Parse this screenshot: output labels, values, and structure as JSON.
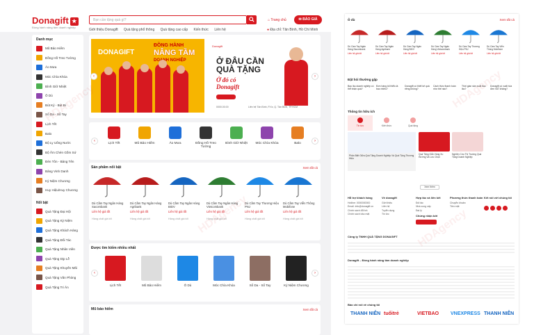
{
  "header": {
    "brand": "Donagift",
    "tagline": "Đồng hành nâng tầm doanh nghiệp",
    "search_placeholder": "Bạn cần tặng quà gì?",
    "home_link": "Trang chủ",
    "quote_button": "BÁO GIÁ",
    "location": "Địa chỉ: Tân Bình, Hồ Chí Minh",
    "nav": [
      "Giới thiệu Donagift",
      "Quà tặng phổ thông",
      "Quà tặng cao cấp",
      "Kiến thức",
      "Liên hệ"
    ]
  },
  "sidebar": {
    "title_categories": "Danh mục",
    "categories": [
      "Mũ Bảo Hiểm",
      "Đồng Hồ Treo Tường",
      "Áo Mưa",
      "Móc Chìa Khóa",
      "Bình Giữ Nhiệt",
      "Ô Dù",
      "Bút Ký - Bút Bi",
      "Sổ Da - Sổ Tay",
      "Lịch Tết",
      "Balo",
      "Bộ Ly Uống Nước",
      "Bộ Ấm Chén Gốm Sứ",
      "Đèn Tôn - Bảng Tên",
      "Bảng Vinh Danh",
      "Kỷ Niệm Chương",
      "Huy Hiệu/Huy Chương"
    ],
    "title_featured": "Nổi bật",
    "featured": [
      "Quà Tặng Đại Hội",
      "Quà Tặng Kỷ Niệm",
      "Quà Tặng Khách Hàng",
      "Quà Tặng Đối Tác",
      "Quà Tặng Nhân Viên",
      "Quà Tặng Dịp Lễ",
      "Quà Tặng Khuyến Mãi",
      "Quà Tặng Văn Phòng",
      "Quà Tặng Tri Ân"
    ]
  },
  "banner": {
    "left_brand": "DONAGIFT",
    "left_line1": "ĐỒNG HÀNH",
    "left_line2": "NÂNG TẦM",
    "left_line3": "DOANH NGHIỆP",
    "right_small": "Donagift",
    "right_title1": "Ở ĐÂU CẦN",
    "right_title2": "QUÀ TẶNG",
    "right_script1": "Ở đó có",
    "right_script2": "Donagift",
    "right_phone": "0000.00.00",
    "right_address": "Liên hệ Tân Bình, P.Xx, Q. Tân Bình, TP.HCM"
  },
  "quick_categories": [
    "Lịch Tết",
    "Mũ Bảo Hiểm",
    "Áo Mưa",
    "Đồng Hồ Treo Tường",
    "Bình Giữ Nhiệt",
    "Móc Chìa Khóa",
    "Balo"
  ],
  "featured_section": {
    "title": "Sản phẩm nổi bật",
    "more": "Xem tất cả",
    "products": [
      {
        "name": "Dù Cầm Tay Ngân Hàng Sacombank",
        "price": "Liên hệ giá tốt",
        "stock": "Hàng chất giá tốt"
      },
      {
        "name": "Dù Cầm Tay Ngân Hàng Agribank",
        "price": "Liên hệ giá tốt",
        "stock": "Hàng chất giá tốt"
      },
      {
        "name": "Dù Cầm Tay Ngân Hàng BIDV",
        "price": "Liên hệ giá tốt",
        "stock": "Hàng chất giá tốt"
      },
      {
        "name": "Dù Cầm Tay Ngân Hàng Vietcombank",
        "price": "Liên hệ giá tốt",
        "stock": "Hàng chất giá tốt"
      },
      {
        "name": "Dù Cầm Tay Thương Hiệu PNJ",
        "price": "Liên hệ giá tốt",
        "stock": "Hàng chất giá tốt"
      },
      {
        "name": "Dù Cầm Tay Viễn Thông Mobifone",
        "price": "Liên hệ giá tốt",
        "stock": "Hàng chất giá tốt"
      }
    ]
  },
  "searched_section": {
    "title": "Được tìm kiếm nhiều nhất",
    "items": [
      "Lịch Tết",
      "Mũ Bảo Hiểm",
      "Ô Dù",
      "Móc Chìa Khóa",
      "Sổ Da - Sổ Tay",
      "Kỷ Niệm Chương"
    ]
  },
  "helmet_section": {
    "title": "Mũ bảo hiểm",
    "more": "Xem tất cả"
  },
  "right_panel": {
    "umbrella_title": "Ô dù",
    "umbrella_more": "Xem tất cả",
    "umbrellas": [
      {
        "name": "Dù Cầm Tay Ngân Hàng Sacombank",
        "price": "Liên hệ giá tốt"
      },
      {
        "name": "Dù Cầm Tay Ngân Hàng Agribank",
        "price": "Liên hệ giá tốt"
      },
      {
        "name": "Dù Cầm Tay Ngân Hàng BIDV",
        "price": "Liên hệ giá tốt"
      },
      {
        "name": "Dù Cầm Tay Ngân Hàng Vietcombank",
        "price": "Liên hệ giá tốt"
      },
      {
        "name": "Dù Cầm Tay Thương Hiệu PNJ",
        "price": "Liên hệ giá tốt"
      },
      {
        "name": "Dù Cầm Tay Viễn Thông Mobifone",
        "price": "Liên hệ giá tốt"
      }
    ],
    "qa_title": "Đặt hỏi thường gặp",
    "qa": [
      "Bao lâu doanh nghiệp có thể nhận quà?",
      "Đơn hàng tối thiểu là bao nhiêu?",
      "Donagift có thiết kế quà riêng không?",
      "Cách thức thanh toán như thế nào?",
      "Thời gian sản xuất bao lâu?",
      "Donagift có xuất hóa đơn VAT không?"
    ],
    "news_title": "Thông tin hữu ích",
    "tabs": [
      "Tin tức",
      "Kiến thức",
      "Quà tặng"
    ],
    "news_hero": "Phân Biệt Giữa Quà Tặng Doanh Nghiệp Và Quà Tặng Thương Hiệu",
    "news": [
      "Quà Tặng Gắn Vàng Xu Hướng Và Lưu Chọn",
      "Nghiên Cứu Thị Trường Quà Tặng Doanh Nghiệp"
    ],
    "news_more": "Xem thêm",
    "footer_cols": [
      {
        "title": "Hỗ trợ khách hàng",
        "lines": [
          "Hotline: 0000000000",
          "Email: info@donagift.vn",
          "Chính sách đổi trả",
          "Chính sách bảo mật"
        ]
      },
      {
        "title": "Về donagift",
        "lines": [
          "Giới thiệu",
          "Liên hệ",
          "Tuyển dụng",
          "Tin tức"
        ]
      },
      {
        "title": "Hợp tác và liên kết",
        "lines": [
          "Đối tác",
          "Nhà cung cấp",
          "Đại lý"
        ]
      },
      {
        "title": "Phương thức thanh toán",
        "lines": [
          "Chuyển khoản",
          "Tiền mặt"
        ]
      },
      {
        "title": "Kết nối với chúng tôi",
        "lines": []
      }
    ],
    "cert_title": "Chứng nhận bởi",
    "company_title": "Công ty TNHH QUÀ TẶNG DONAGIFT",
    "about_title": "Donagift – Đồng hành nâng tầm doanh nghiệp",
    "press_title": "Báo chí nói về chúng tôi",
    "press": [
      "THANH NIÊN",
      "tuổitrẻ",
      "VIETBAO",
      "VNEXPRESS",
      "THANH NIÊN"
    ]
  },
  "watermark": "HDAgency",
  "colors": {
    "accent": "#d71920",
    "banner_yellow": "#f7b500"
  }
}
